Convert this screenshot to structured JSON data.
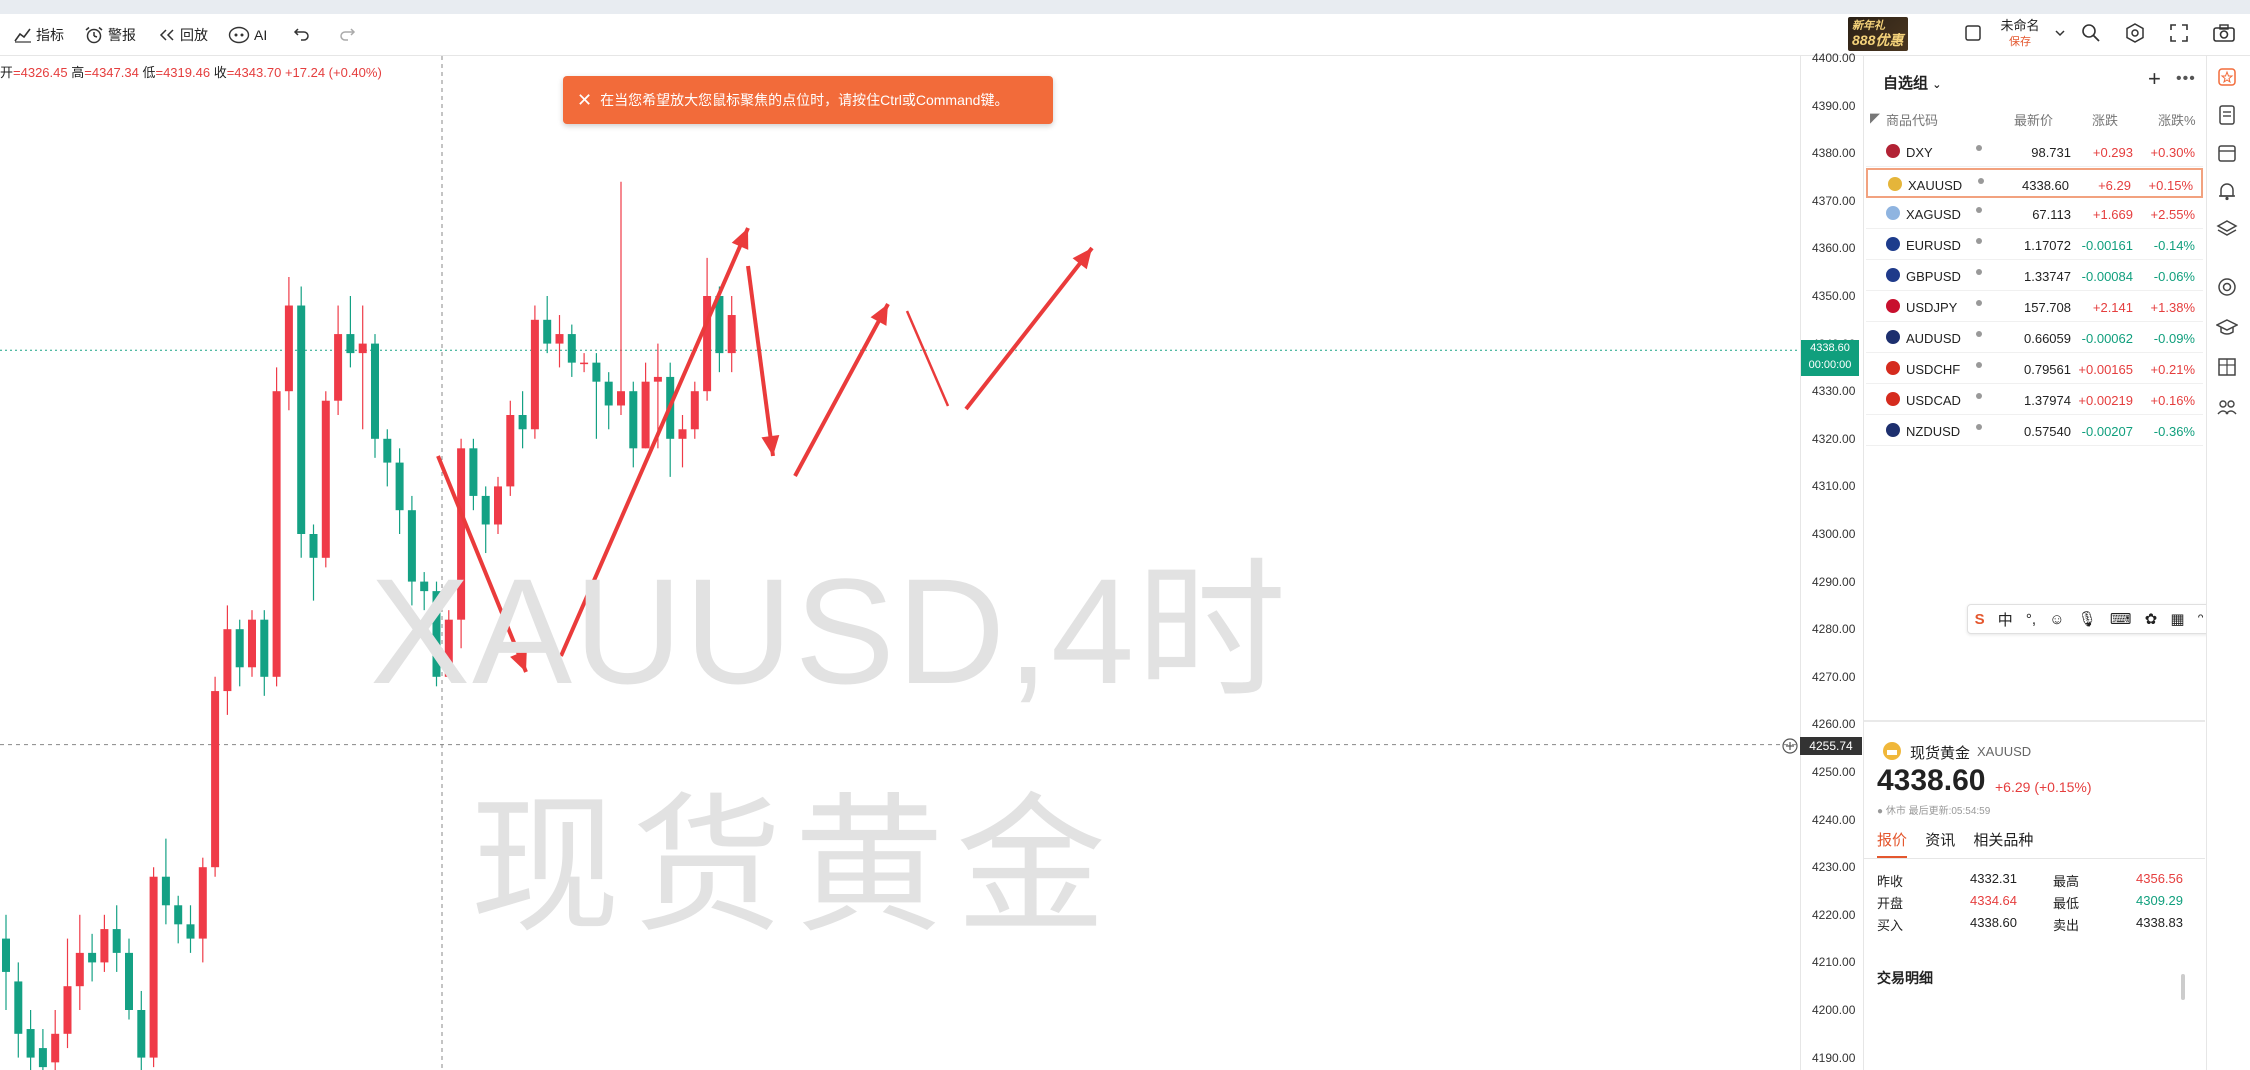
{
  "toolbar": {
    "indicators": "指标",
    "alert": "警报",
    "replay": "回放",
    "ai": "AI",
    "promo_line1": "新年礼",
    "promo_line2": "888优惠",
    "layout_name": "未命名",
    "layout_save": "保存"
  },
  "ohlc": {
    "open_label": "开",
    "open": "=4326.45",
    "high_label": "高",
    "high": "=4347.34",
    "low_label": "低",
    "low": "=4319.46",
    "close_label": "收",
    "close": "=4343.70",
    "change": "+17.24 (+0.40%)"
  },
  "toast": {
    "text": "在当您希望放大您鼠标聚焦的点位时，请按住Ctrl或Command键。"
  },
  "watermark": {
    "symbol": "XAUUSD,4时",
    "name": "现货黄金"
  },
  "yaxis": {
    "ticks": [
      "4400.00",
      "4390.00",
      "4380.00",
      "4370.00",
      "4360.00",
      "4350.00",
      "4340.00",
      "4330.00",
      "4320.00",
      "4310.00",
      "4300.00",
      "4290.00",
      "4280.00",
      "4270.00",
      "4260.00",
      "4250.00",
      "4240.00",
      "4230.00",
      "4220.00",
      "4210.00",
      "4200.00",
      "4190.00"
    ],
    "price_tag": "4338.60",
    "price_time": "00:00:00",
    "crosshair_price": "4255.74"
  },
  "watchlist": {
    "title": "自选组",
    "columns": {
      "code": "商品代码",
      "last": "最新价",
      "change": "涨跌",
      "change_pct": "涨跌%"
    },
    "rows": [
      {
        "code": "DXY",
        "last": "98.731",
        "change": "+0.293",
        "pct": "+0.30%",
        "dir": "up",
        "flag": "#b22234"
      },
      {
        "code": "XAUUSD",
        "last": "4338.60",
        "change": "+6.29",
        "pct": "+0.15%",
        "dir": "up",
        "flag": "#e5b53a"
      },
      {
        "code": "XAGUSD",
        "last": "67.113",
        "change": "+1.669",
        "pct": "+2.55%",
        "dir": "up",
        "flag": "#8fb4e0"
      },
      {
        "code": "EURUSD",
        "last": "1.17072",
        "change": "-0.00161",
        "pct": "-0.14%",
        "dir": "dn",
        "flag": "#1d3c8c"
      },
      {
        "code": "GBPUSD",
        "last": "1.33747",
        "change": "-0.00084",
        "pct": "-0.06%",
        "dir": "dn",
        "flag": "#1f3a8a"
      },
      {
        "code": "USDJPY",
        "last": "157.708",
        "change": "+2.141",
        "pct": "+1.38%",
        "dir": "up",
        "flag": "#c8102e"
      },
      {
        "code": "AUDUSD",
        "last": "0.66059",
        "change": "-0.00062",
        "pct": "-0.09%",
        "dir": "dn",
        "flag": "#1d2f6e"
      },
      {
        "code": "USDCHF",
        "last": "0.79561",
        "change": "+0.00165",
        "pct": "+0.21%",
        "dir": "up",
        "flag": "#d52b1e"
      },
      {
        "code": "USDCAD",
        "last": "1.37974",
        "change": "+0.00219",
        "pct": "+0.16%",
        "dir": "up",
        "flag": "#d52b1e"
      },
      {
        "code": "NZDUSD",
        "last": "0.57540",
        "change": "-0.00207",
        "pct": "-0.36%",
        "dir": "dn",
        "flag": "#1d2f6e"
      }
    ]
  },
  "detail": {
    "name": "现货黄金",
    "code": "XAUUSD",
    "price": "4338.60",
    "change": "+6.29 (+0.15%)",
    "status": "● 休市 最后更新:05:54:59",
    "tabs": [
      "报价",
      "资讯",
      "相关品种"
    ],
    "stats": {
      "prev_close_label": "昨收",
      "prev_close": "4332.31",
      "high_label": "最高",
      "high": "4356.56",
      "open_label": "开盘",
      "open": "4334.64",
      "low_label": "最低",
      "low": "4309.29",
      "bid_label": "买入",
      "bid": "4338.60",
      "ask_label": "卖出",
      "ask": "4338.83"
    },
    "section": "交易明细"
  },
  "ime": {
    "lang": "中"
  },
  "colors": {
    "up": "#ef3b48",
    "down": "#14a184",
    "accent": "#f26b3a"
  },
  "icons": [
    "indicators-icon",
    "alarm-clock-icon",
    "replay-icon",
    "ai-icon",
    "undo-icon",
    "redo-icon",
    "layout-icon",
    "chevron-down-icon",
    "zoom-icon",
    "settings-icon",
    "fullscreen-icon",
    "camera-icon"
  ]
}
